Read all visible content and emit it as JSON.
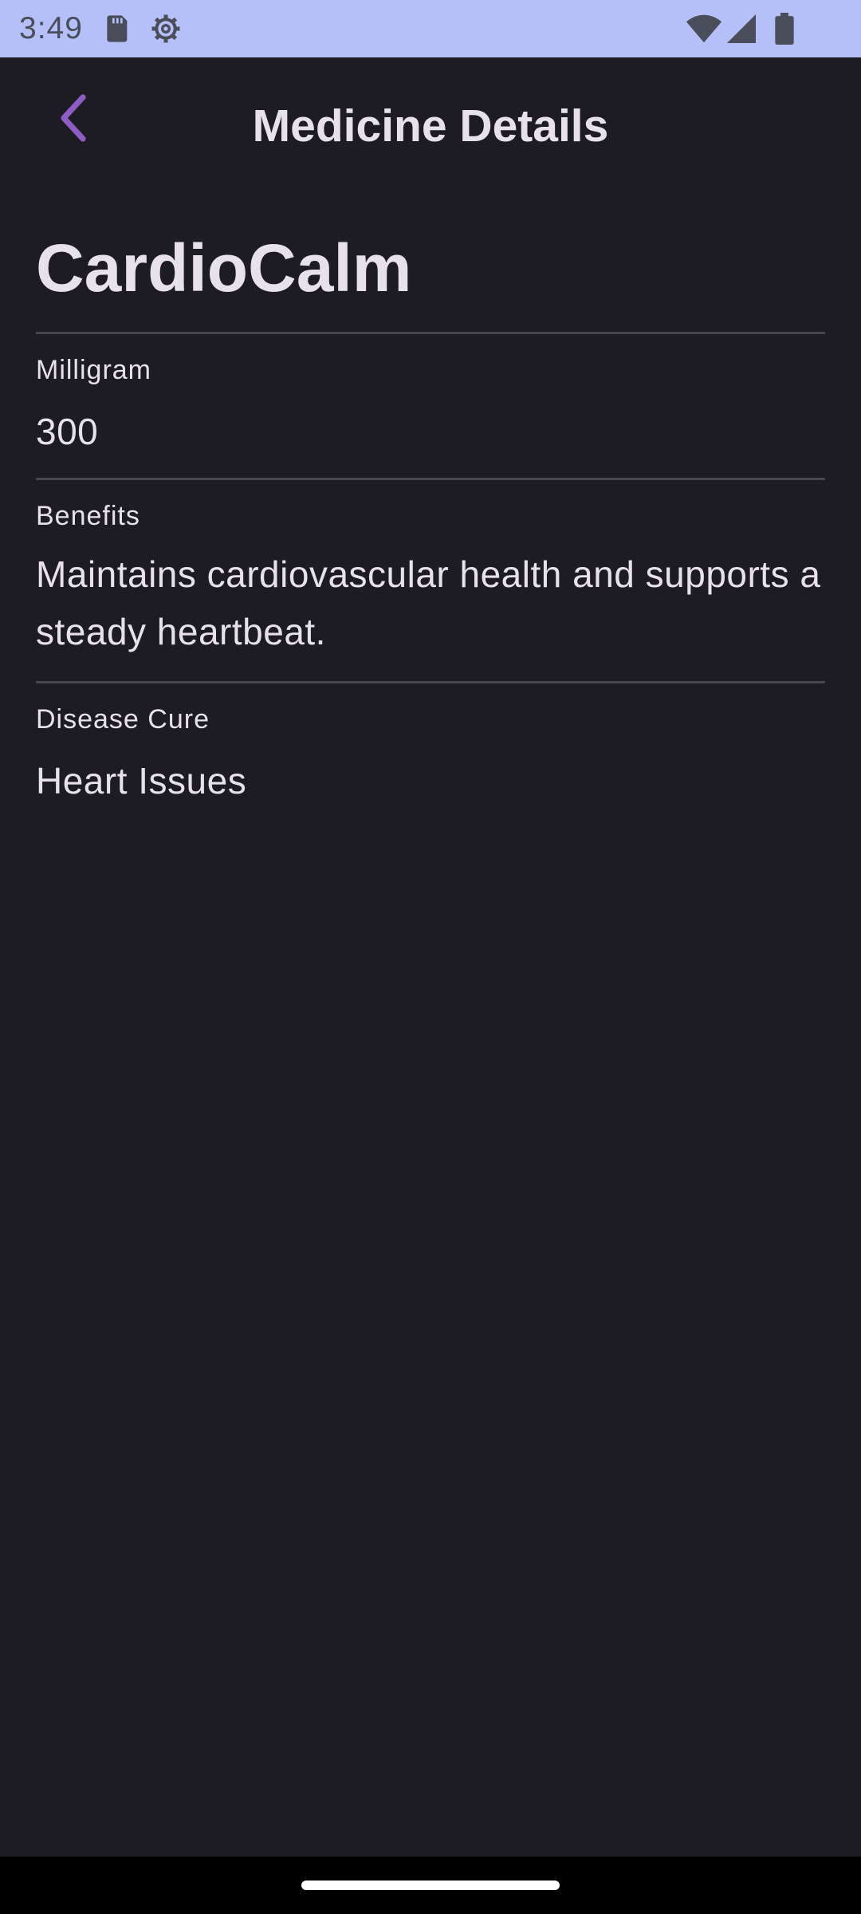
{
  "status_bar": {
    "time": "3:49",
    "icons": [
      "sd-card-icon",
      "settings-icon",
      "wifi-icon",
      "signal-icon",
      "battery-icon"
    ]
  },
  "header": {
    "title": "Medicine Details",
    "back_icon": "chevron-left-icon",
    "accent_color": "#8f5bc4"
  },
  "medicine": {
    "name": "CardioCalm",
    "fields": [
      {
        "label": "Milligram",
        "value": "300"
      },
      {
        "label": "Benefits",
        "value": "Maintains cardiovascular health and supports a steady heartbeat."
      },
      {
        "label": "Disease Cure",
        "value": "Heart Issues"
      }
    ]
  },
  "colors": {
    "background": "#1d1c22",
    "status_bar": "#b4c0f7",
    "divider": "#48464d",
    "text": "#e7e1ea"
  }
}
